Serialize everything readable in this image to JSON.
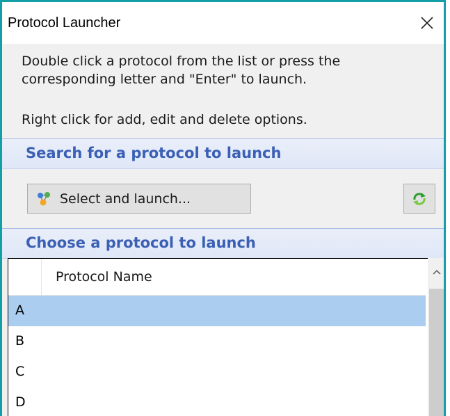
{
  "window": {
    "title": "Protocol Launcher",
    "close_icon": "close-icon",
    "accent_color": "#12a0a6"
  },
  "info": {
    "line1": "Double click a protocol from the list or press the",
    "line2": "corresponding letter and \"Enter\" to launch.",
    "line3": "Right click for add, edit and delete options."
  },
  "search_section": {
    "title": "Search for a protocol to launch",
    "select_button_label": "Select and launch...",
    "select_icon": "molecule-icon",
    "refresh_icon": "refresh-icon"
  },
  "choose_section": {
    "title": "Choose a protocol to launch"
  },
  "grid": {
    "column_header": "Protocol Name",
    "rows": [
      {
        "letter": "A",
        "name": "",
        "selected": true
      },
      {
        "letter": "B",
        "name": "",
        "selected": false
      },
      {
        "letter": "C",
        "name": "",
        "selected": false
      },
      {
        "letter": "D",
        "name": "",
        "selected": false
      }
    ]
  },
  "colors": {
    "section_title": "#3a5fb4",
    "selected_row": "#aacdf0"
  }
}
